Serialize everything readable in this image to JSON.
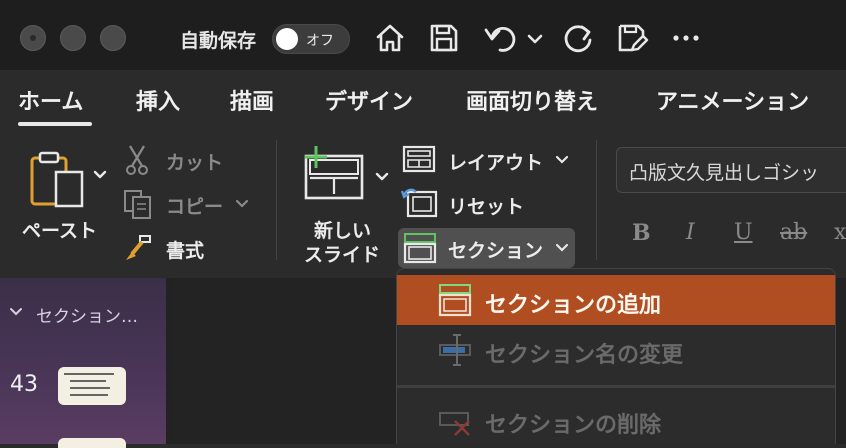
{
  "titlebar": {
    "autosave_label": "自動保存",
    "autosave_state": "オフ",
    "icons": [
      "home-icon",
      "save-icon",
      "undo-icon",
      "chevron-down-icon",
      "redo-icon",
      "save-edit-icon",
      "more-icon"
    ]
  },
  "tabs": [
    {
      "label": "ホーム",
      "active": true
    },
    {
      "label": "挿入"
    },
    {
      "label": "描画"
    },
    {
      "label": "デザイン"
    },
    {
      "label": "画面切り替え"
    },
    {
      "label": "アニメーション"
    }
  ],
  "ribbon": {
    "paste": "ペースト",
    "cut": "カット",
    "copy": "コピー",
    "format": "書式",
    "new_slide_line1": "新しい",
    "new_slide_line2": "スライド",
    "layout": "レイアウト",
    "reset": "リセット",
    "section": "セクション",
    "font_name": "凸版文久見出しゴシッ",
    "bold": "B",
    "italic": "I",
    "underline": "U",
    "strikethrough": "ab",
    "more_format": "x"
  },
  "left_panel": {
    "section_header": "セクション…",
    "slide_number": "43"
  },
  "section_menu": {
    "items": [
      {
        "label": "セクションの追加",
        "enabled": true,
        "highlighted": true
      },
      {
        "label": "セクション名の変更",
        "enabled": false
      },
      {
        "label": "セクションの削除",
        "enabled": false
      }
    ]
  },
  "colors": {
    "highlight": "#b04e22",
    "accent_green": "#5fc45f",
    "clipboard_orange": "#e0a030"
  }
}
